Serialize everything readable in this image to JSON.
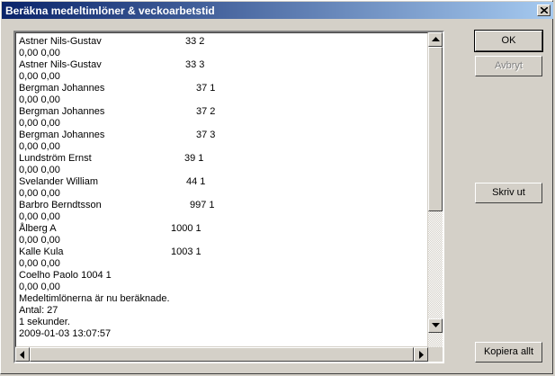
{
  "window": {
    "title": "Beräkna medeltimlöner & veckoarbetstid"
  },
  "buttons": {
    "ok": "OK",
    "cancel": "Avbryt",
    "print": "Skriv ut",
    "copy_all": "Kopiera allt"
  },
  "log_lines": [
    {
      "text": "Astner Nils-Gustav",
      "num": "33 2"
    },
    {
      "text": "0,00 0,00"
    },
    {
      "text": "Astner Nils-Gustav",
      "num": "33 3"
    },
    {
      "text": "0,00 0,00"
    },
    {
      "text": "Bergman Johannes",
      "num": "37 1"
    },
    {
      "text": "0,00 0,00"
    },
    {
      "text": "Bergman Johannes",
      "num": "37 2"
    },
    {
      "text": "0,00 0,00"
    },
    {
      "text": "Bergman Johannes",
      "num": "37 3"
    },
    {
      "text": "0,00 0,00"
    },
    {
      "text": "Lundström Ernst",
      "num": "39 1"
    },
    {
      "text": "0,00 0,00"
    },
    {
      "text": "Svelander William",
      "num": "44 1"
    },
    {
      "text": "0,00 0,00"
    },
    {
      "text": "Barbro Berndtsson",
      "num": "997 1"
    },
    {
      "text": "0,00 0,00"
    },
    {
      "text": "Ålberg A",
      "num": "1000 1"
    },
    {
      "text": "0,00 0,00"
    },
    {
      "text": "Kalle Kula",
      "num": "1003 1"
    },
    {
      "text": "0,00 0,00"
    },
    {
      "text": "Coelho Paolo 1004 1"
    },
    {
      "text": "0,00 0,00"
    },
    {
      "text": "Medeltimlönerna är nu beräknade."
    },
    {
      "text": "Antal: 27"
    },
    {
      "text": "1 sekunder."
    },
    {
      "text": "2009-01-03 13:07:57"
    }
  ]
}
